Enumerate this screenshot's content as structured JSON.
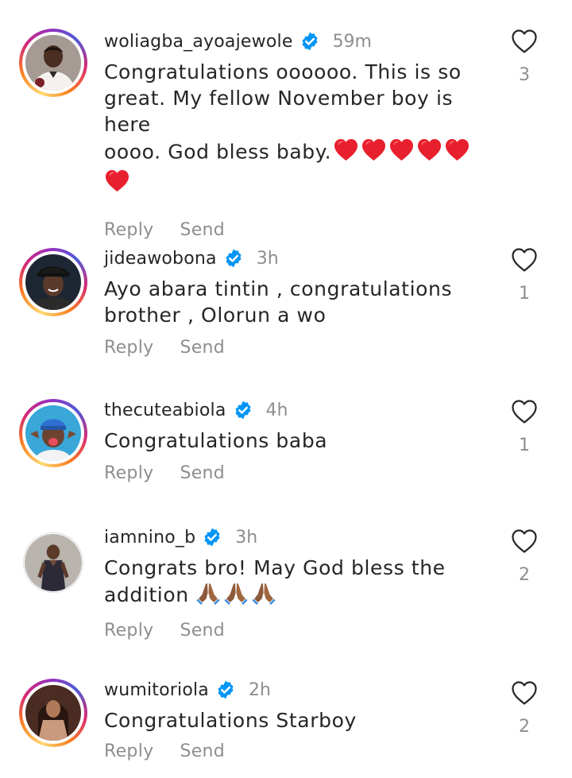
{
  "actions": {
    "reply_label": "Reply",
    "send_label": "Send"
  },
  "colors": {
    "text": "#262626",
    "secondary": "#8e8e8e",
    "verified": "#0095f6",
    "heart_red": "#ed1c2e"
  },
  "comments": [
    {
      "username": "woliagba_ayoajewole",
      "verified": true,
      "time": "59m",
      "text_lines": [
        "Congratulations oooooo. This is so",
        "great. My fellow November boy is here",
        "oooo. God bless baby."
      ],
      "emoji": "red-heart x6",
      "likes": "3",
      "story_ring": true
    },
    {
      "username": "jideawobona",
      "verified": true,
      "time": "3h",
      "text_lines": [
        "Ayo abara tintin , congratulations",
        "brother , Olorun a wo"
      ],
      "likes": "1",
      "story_ring": true
    },
    {
      "username": "thecuteabiola",
      "verified": true,
      "time": "4h",
      "text_lines": [
        "Congratulations baba"
      ],
      "likes": "1",
      "story_ring": true
    },
    {
      "username": "iamnino_b",
      "verified": true,
      "time": "3h",
      "text_lines": [
        "Congrats bro! May God bless the",
        "addition"
      ],
      "emoji": "folded-hands x3",
      "likes": "2",
      "story_ring": false
    },
    {
      "username": "wumitoriola",
      "verified": true,
      "time": "2h",
      "text_lines": [
        "Congratulations Starboy"
      ],
      "likes": "2",
      "story_ring": true
    }
  ]
}
